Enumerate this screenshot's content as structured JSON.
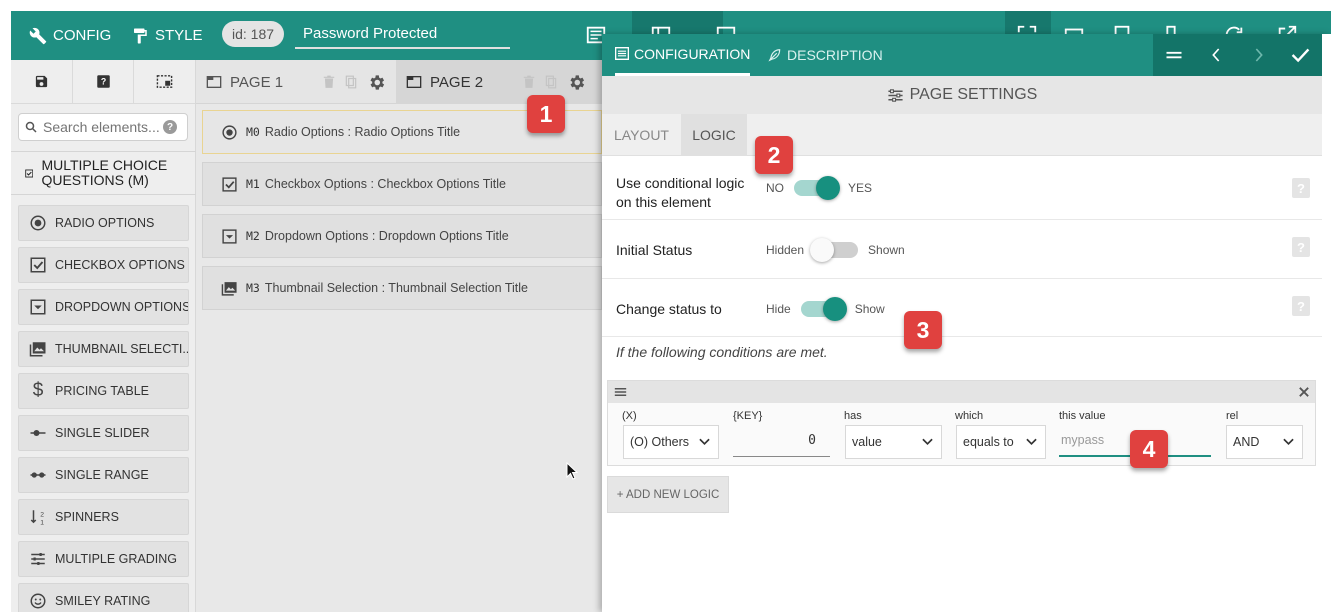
{
  "topbar": {
    "config_label": "CONFIG",
    "style_label": "STYLE",
    "id_badge": "id: 187",
    "form_name": "Password Protected"
  },
  "sidebar": {
    "search_placeholder": "Search elements...",
    "category": "Multiple Choice Questions (M)",
    "elements": [
      {
        "label": "RADIO OPTIONS",
        "icon": "radio-icon"
      },
      {
        "label": "CHECKBOX OPTIONS",
        "icon": "checkbox-icon"
      },
      {
        "label": "DROPDOWN OPTIONS",
        "icon": "dropdown-icon"
      },
      {
        "label": "THUMBNAIL SELECTI...",
        "icon": "image-icon"
      },
      {
        "label": "PRICING TABLE",
        "icon": "dollar-icon"
      },
      {
        "label": "SINGLE SLIDER",
        "icon": "slider-icon"
      },
      {
        "label": "SINGLE RANGE",
        "icon": "range-icon"
      },
      {
        "label": "SPINNERS",
        "icon": "spinner-icon"
      },
      {
        "label": "MULTIPLE GRADING",
        "icon": "sliders-icon"
      },
      {
        "label": "SMILEY RATING",
        "icon": "smiley-icon"
      }
    ]
  },
  "pages": {
    "tabs": [
      {
        "label": "PAGE 1"
      },
      {
        "label": "PAGE 2"
      }
    ],
    "items": [
      {
        "code": "M0",
        "label": "Radio Options : Radio Options Title",
        "icon": "radio-icon"
      },
      {
        "code": "M1",
        "label": "Checkbox Options : Checkbox Options Title",
        "icon": "checkbox-icon"
      },
      {
        "code": "M2",
        "label": "Dropdown Options : Dropdown Options Title",
        "icon": "dropdown-icon"
      },
      {
        "code": "M3",
        "label": "Thumbnail Selection : Thumbnail Selection Title",
        "icon": "image-icon"
      }
    ]
  },
  "panel": {
    "tab_configuration": "CONFIGURATION",
    "tab_description": "DESCRIPTION",
    "page_settings": "PAGE SETTINGS",
    "subtab_layout": "LAYOUT",
    "subtab_logic": "LOGIC",
    "rows": {
      "conditional": {
        "label": "Use conditional logic on this element",
        "off": "NO",
        "on": "YES",
        "state": true
      },
      "initial": {
        "label": "Initial Status",
        "off": "Hidden",
        "on": "Shown",
        "state": false
      },
      "change": {
        "label": "Change status to",
        "off": "Hide",
        "on": "Show",
        "state": true
      }
    },
    "conditions_text": "If the following conditions are met.",
    "logic": {
      "x_label": "(X)",
      "x_value": "(O) Others",
      "key_label": "{KEY}",
      "key_value": "0",
      "has_label": "has",
      "has_value": "value",
      "which_label": "which",
      "which_value": "equals to",
      "this_value_label": "this value",
      "this_value": "mypass",
      "rel_label": "rel",
      "rel_value": "AND"
    },
    "add_logic": "+ ADD NEW LOGIC"
  },
  "callouts": [
    "1",
    "2",
    "3",
    "4"
  ],
  "colors": {
    "primary": "#1f8f82",
    "primary_dark": "#137468",
    "badge": "#e0413f"
  }
}
